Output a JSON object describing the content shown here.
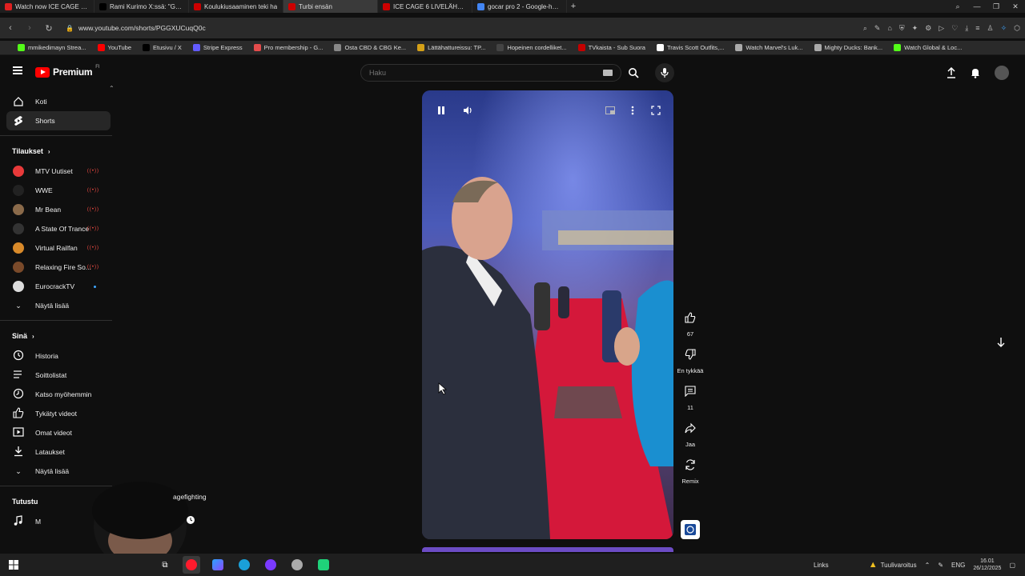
{
  "browser": {
    "tabs": [
      {
        "label": "Watch now ICE CAGE 6 | L",
        "color": "#e02020"
      },
      {
        "label": "Rami Kurimo X:ssä: \"Greta",
        "color": "#000000"
      },
      {
        "label": "Koulukiusaaminen teki ha",
        "color": "#cc0000"
      },
      {
        "label": "Turbi ensän",
        "color": "#cc0000"
      },
      {
        "label": "ICE CAGE 6 LIVELÄHETYS",
        "color": "#cc0000"
      },
      {
        "label": "gocar pro 2 - Google-haku",
        "color": "#4285f4"
      }
    ],
    "new_tab": "+",
    "url": "www.youtube.com/shorts/PGGXUCuqQ0c",
    "bookmarks": [
      {
        "label": "mmikedimayn Strea...",
        "color": "#53fc18"
      },
      {
        "label": "YouTube",
        "color": "#ff0000"
      },
      {
        "label": "Etusivu / X",
        "color": "#000000"
      },
      {
        "label": "Stripe Express",
        "color": "#635bff"
      },
      {
        "label": "Pro membership - G...",
        "color": "#e34c4c"
      },
      {
        "label": "Osta CBD & CBG Ke...",
        "color": "#888888"
      },
      {
        "label": "Lättähattureissu: TP...",
        "color": "#d4a017"
      },
      {
        "label": "Hopeinen cordelliket...",
        "color": "#444444"
      },
      {
        "label": "TVkaista - Sub Suora",
        "color": "#c40000"
      },
      {
        "label": "Travis Scott Outfits,...",
        "color": "#ffffff"
      },
      {
        "label": "Watch Marvel's Luk...",
        "color": "#aaaaaa"
      },
      {
        "label": "Mighty Ducks: Bank...",
        "color": "#aaaaaa"
      },
      {
        "label": "Watch Global & Loc...",
        "color": "#53fc18"
      }
    ]
  },
  "header": {
    "logo_text": "Premium",
    "logo_region": "FI",
    "search_placeholder": "Haku"
  },
  "sidebar": {
    "main": [
      {
        "label": "Koti",
        "icon": "home-icon"
      },
      {
        "label": "Shorts",
        "icon": "shorts-icon"
      }
    ],
    "subscriptions_title": "Tilaukset",
    "subscriptions": [
      {
        "label": "MTV Uutiset",
        "color": "#e83a3a",
        "indicator": "live"
      },
      {
        "label": "WWE",
        "color": "#222222",
        "indicator": "live"
      },
      {
        "label": "Mr Bean",
        "color": "#8a6a4a",
        "indicator": "live"
      },
      {
        "label": "A State Of Trance",
        "color": "#333333",
        "indicator": "live"
      },
      {
        "label": "Virtual Railfan",
        "color": "#d98a2a",
        "indicator": "live"
      },
      {
        "label": "Relaxing Fire So...",
        "color": "#7a4a2a",
        "indicator": "live"
      },
      {
        "label": "EurocrackTV",
        "color": "#dddddd",
        "indicator": "dot"
      }
    ],
    "show_more_1": "Näytä lisää",
    "you_title": "Sinä",
    "you_items": [
      {
        "label": "Historia",
        "icon": "history-icon"
      },
      {
        "label": "Soittolistat",
        "icon": "playlists-icon"
      },
      {
        "label": "Katso myöhemmin",
        "icon": "watch-later-icon"
      },
      {
        "label": "Tykätyt videot",
        "icon": "liked-videos-icon"
      },
      {
        "label": "Omat videot",
        "icon": "my-videos-icon"
      },
      {
        "label": "Lataukset",
        "icon": "downloads-icon"
      }
    ],
    "show_more_2": "Näytä lisää",
    "explore_title": "Tutustu",
    "explore_items": [
      {
        "label": "M",
        "icon": "music-icon"
      }
    ]
  },
  "short": {
    "actions": {
      "likes": "67",
      "dislike_label": "En tykkää",
      "comments": "11",
      "share_label": "Jaa",
      "remix_label": "Remix"
    }
  },
  "overlay_text": "agefighting",
  "taskbar": {
    "links_label": "Links",
    "weather_label": "Tuulivaroitus",
    "language": "ENG",
    "time": "16.01",
    "date": "26/12/2025"
  }
}
